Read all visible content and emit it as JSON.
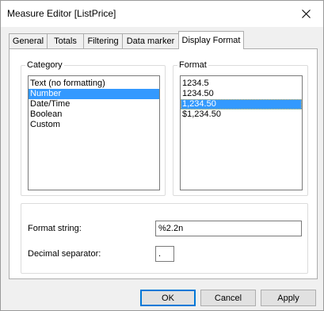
{
  "window": {
    "title": "Measure Editor [ListPrice]"
  },
  "tabs": [
    {
      "label": "General"
    },
    {
      "label": "Totals"
    },
    {
      "label": "Filtering"
    },
    {
      "label": "Data marker"
    },
    {
      "label": "Display Format",
      "active": true
    }
  ],
  "category": {
    "legend": "Category",
    "items": [
      "Text (no formatting)",
      "Number",
      "Date/Time",
      "Boolean",
      "Custom"
    ],
    "selected": "Number"
  },
  "format": {
    "legend": "Format",
    "items": [
      "1234.5",
      "1234.50",
      "1,234.50",
      "$1,234.50"
    ],
    "selected": "1,234.50"
  },
  "format_string": {
    "label": "Format string:",
    "value": "%2.2n"
  },
  "decimal_separator": {
    "label": "Decimal separator:",
    "value": "."
  },
  "buttons": {
    "ok": "OK",
    "cancel": "Cancel",
    "apply": "Apply"
  },
  "colors": {
    "selection": "#3399ff",
    "default_button_border": "#0078d7"
  },
  "icons": {
    "close": "close-icon"
  }
}
